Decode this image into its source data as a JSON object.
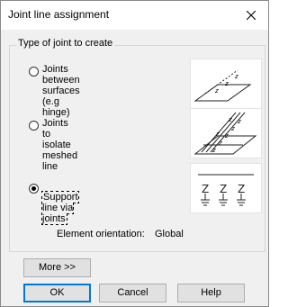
{
  "dialog": {
    "title": "Joint line assignment"
  },
  "group": {
    "label": "Type of joint to create"
  },
  "options": [
    {
      "label": "Joints between surfaces\n(e.g hinge)",
      "selected": false,
      "icon": "hinge-surfaces-icon"
    },
    {
      "label": "Joints to isolate meshed\nline",
      "selected": false,
      "icon": "isolate-meshed-line-icon"
    },
    {
      "label": "Support line via joints",
      "selected": true,
      "icon": "support-line-joints-icon"
    }
  ],
  "orientation": {
    "label": "Element orientation:",
    "value": "Global"
  },
  "buttons": {
    "more": "More >>",
    "ok": "OK",
    "cancel": "Cancel",
    "help": "Help"
  },
  "diagram_text": {
    "z": "z"
  },
  "colors": {
    "dialog_bg": "#f0f0f0",
    "default_button_border": "#0078d7"
  }
}
